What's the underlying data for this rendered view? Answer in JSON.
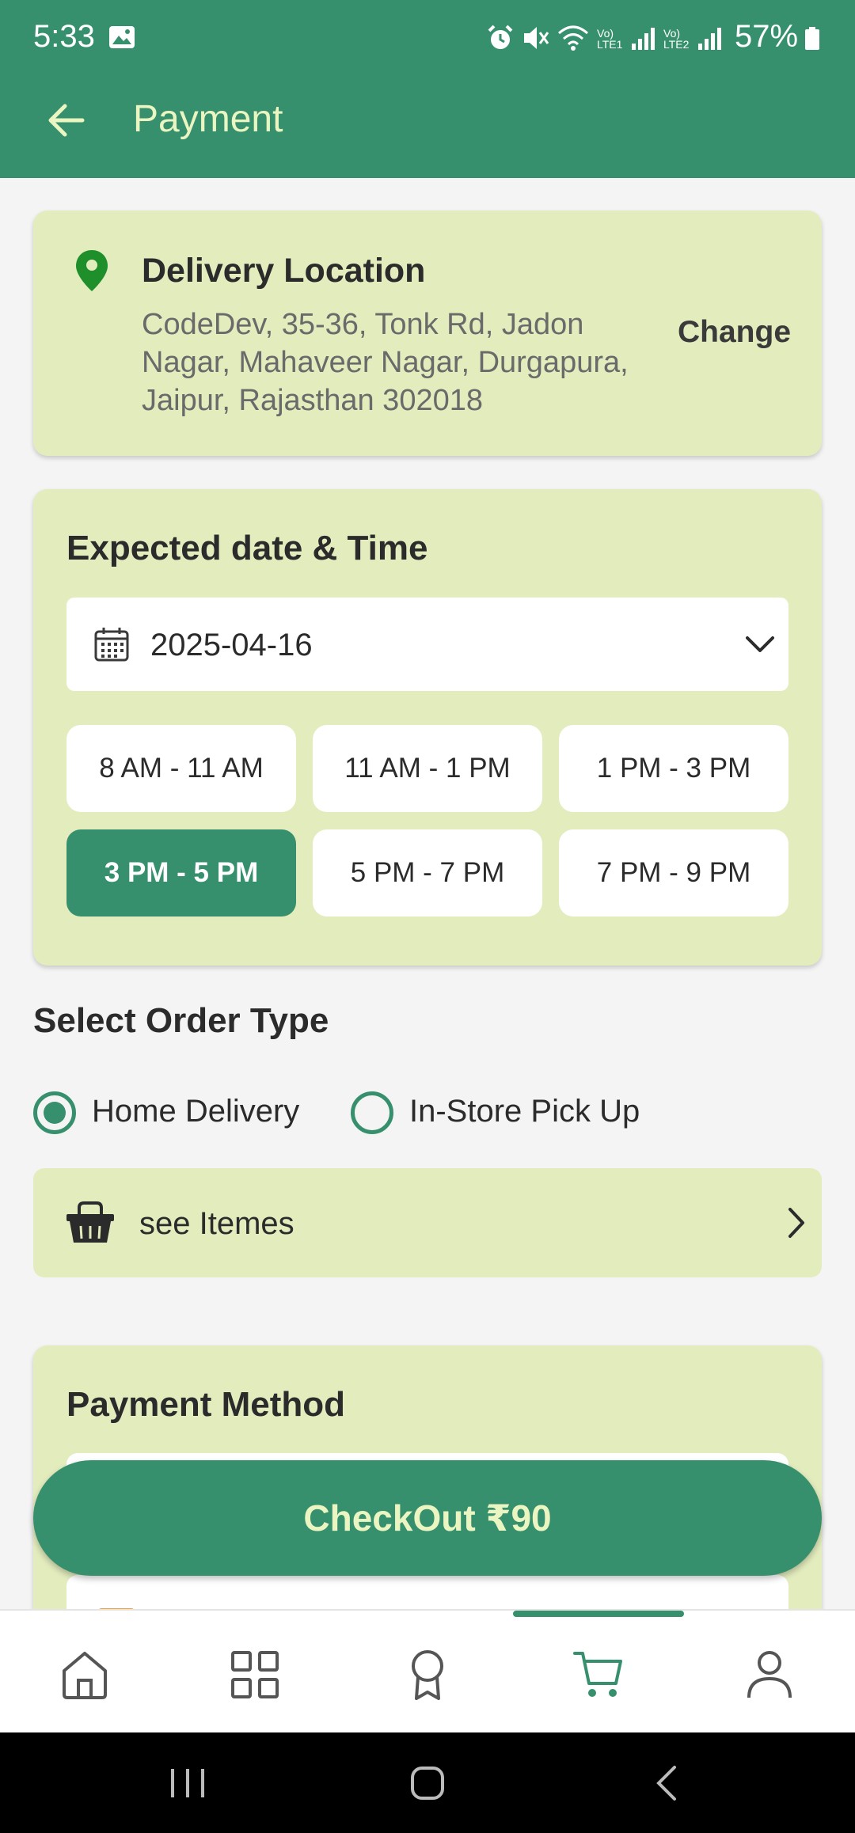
{
  "status_bar": {
    "time": "5:33",
    "battery_percent": "57%",
    "icons": [
      "gallery-icon",
      "alarm-icon",
      "mute-icon",
      "wifi-icon",
      "signal-lte1-icon",
      "signal-lte2-icon",
      "battery-icon"
    ],
    "lte1": "Vo) LTE1",
    "lte2": "Vo) LTE2"
  },
  "header": {
    "title": "Payment",
    "back_icon": "back-arrow-icon"
  },
  "delivery_location": {
    "heading": "Delivery Location",
    "address": "CodeDev, 35-36, Tonk Rd, Jadon Nagar, Mahaveer Nagar, Durgapura, Jaipur, Rajasthan 302018",
    "change_label": "Change",
    "icon": "location-pin-icon"
  },
  "expected_datetime": {
    "heading": "Expected date & Time",
    "selected_date": "2025-04-16",
    "slots": [
      {
        "label": "8 AM - 11 AM",
        "selected": false
      },
      {
        "label": "11 AM - 1 PM",
        "selected": false
      },
      {
        "label": "1 PM - 3 PM",
        "selected": false
      },
      {
        "label": "3 PM - 5 PM",
        "selected": true
      },
      {
        "label": "5 PM - 7 PM",
        "selected": false
      },
      {
        "label": "7 PM - 9 PM",
        "selected": false
      }
    ]
  },
  "order_type": {
    "heading": "Select Order Type",
    "options": [
      {
        "label": "Home Delivery",
        "selected": true
      },
      {
        "label": "In-Store Pick Up",
        "selected": false
      }
    ]
  },
  "items_row": {
    "label": "see Itemes",
    "icon": "basket-icon"
  },
  "payment_method": {
    "heading": "Payment Method"
  },
  "checkout": {
    "label": "CheckOut ₹90"
  },
  "bottom_nav": {
    "items": [
      "home-icon",
      "categories-icon",
      "rewards-icon",
      "cart-icon",
      "profile-icon"
    ],
    "active": "cart-icon"
  },
  "colors": {
    "primary": "#37906d",
    "card_bg": "#e2ecbd",
    "header_text": "#eaf5c2",
    "page_bg": "#f4f4f4"
  }
}
